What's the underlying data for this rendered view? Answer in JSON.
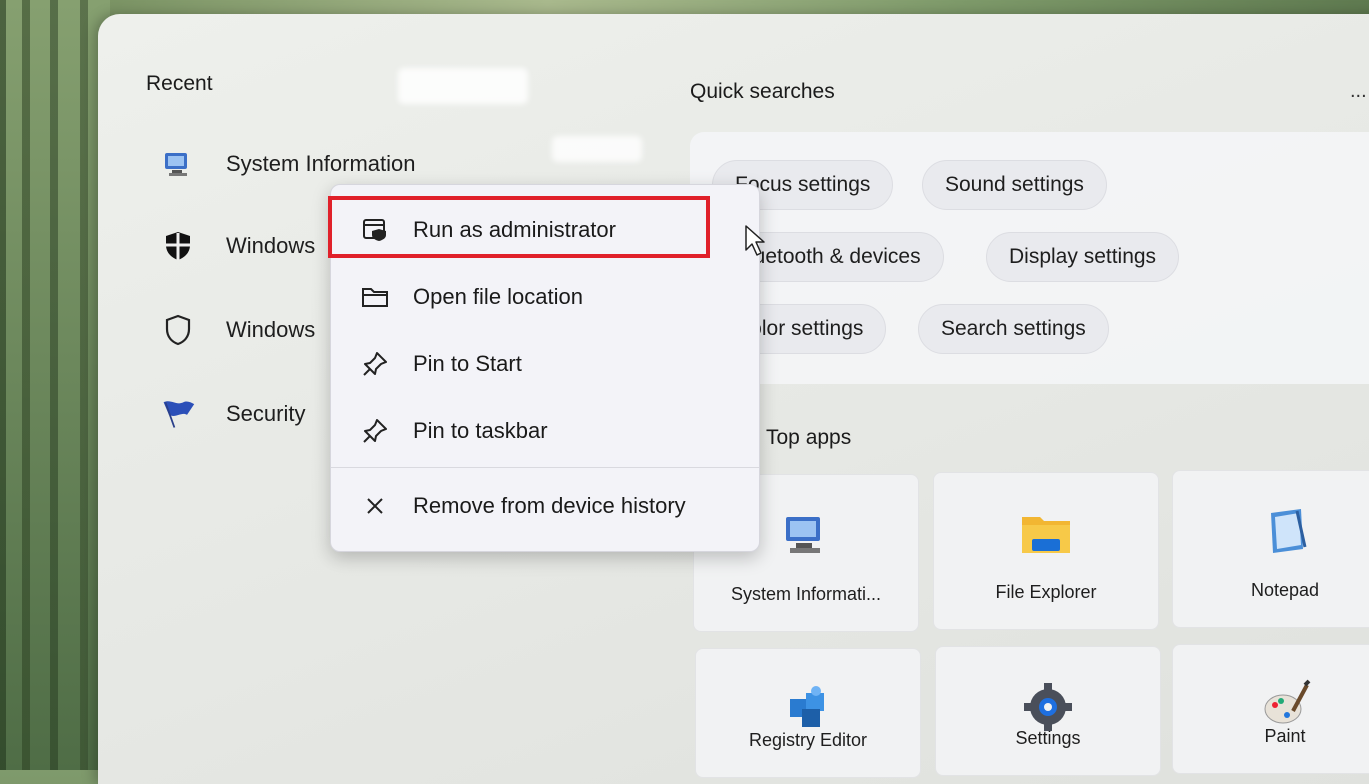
{
  "recent": {
    "title": "Recent",
    "items": [
      {
        "label": "System Information",
        "icon": "system-information-icon"
      },
      {
        "label": "Windows",
        "icon": "windows-security-shield-filled-icon"
      },
      {
        "label": "Windows",
        "icon": "windows-defender-shield-outline-icon"
      },
      {
        "label": "Security",
        "icon": "security-flag-icon"
      }
    ]
  },
  "quick_searches": {
    "title": "Quick searches",
    "more_label": "...",
    "chips": [
      "Focus settings",
      "Sound settings",
      "Bluetooth & devices",
      "Display settings",
      "Color settings",
      "Search settings"
    ]
  },
  "top_apps": {
    "title": "Top apps",
    "tiles": [
      {
        "label": "System Informati...",
        "icon": "system-information-icon"
      },
      {
        "label": "File Explorer",
        "icon": "folder-icon"
      },
      {
        "label": "Notepad",
        "icon": "notepad-icon"
      },
      {
        "label": "Registry Editor",
        "icon": "registry-editor-icon"
      },
      {
        "label": "Settings",
        "icon": "gear-icon"
      },
      {
        "label": "Paint",
        "icon": "paint-palette-icon"
      }
    ]
  },
  "context_menu": {
    "items": [
      {
        "label": "Run as administrator",
        "icon": "admin-shield-window-icon"
      },
      {
        "label": "Open file location",
        "icon": "folder-outline-icon"
      },
      {
        "label": "Pin to Start",
        "icon": "pin-icon"
      },
      {
        "label": "Pin to taskbar",
        "icon": "pin-icon"
      },
      {
        "label": "Remove from device history",
        "icon": "close-icon"
      }
    ],
    "highlight_color": "#e0202a"
  }
}
